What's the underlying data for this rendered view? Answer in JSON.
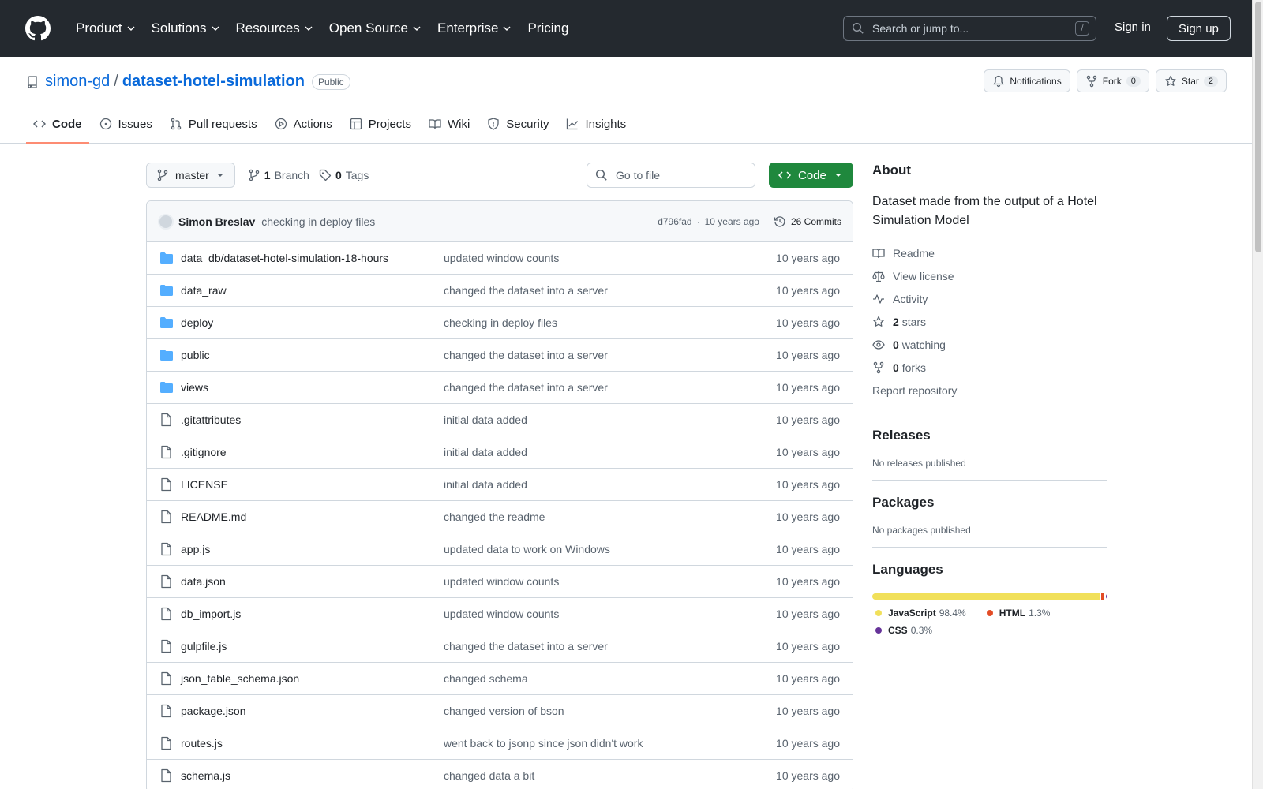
{
  "header": {
    "nav": [
      "Product",
      "Solutions",
      "Resources",
      "Open Source",
      "Enterprise",
      "Pricing"
    ],
    "search_placeholder": "Search or jump to...",
    "search_shortcut": "/",
    "signin": "Sign in",
    "signup": "Sign up"
  },
  "repo": {
    "owner": "simon-gd",
    "separator": "/",
    "name": "dataset-hotel-simulation",
    "visibility": "Public",
    "notifications_label": "Notifications",
    "fork_label": "Fork",
    "fork_count": "0",
    "star_label": "Star",
    "star_count": "2",
    "tabs": [
      "Code",
      "Issues",
      "Pull requests",
      "Actions",
      "Projects",
      "Wiki",
      "Security",
      "Insights"
    ]
  },
  "toolbar": {
    "branch": "master",
    "branch_count": "1",
    "branch_label": "Branch",
    "tag_count": "0",
    "tag_label": "Tags",
    "goto_placeholder": "Go to file",
    "code_button": "Code"
  },
  "commit": {
    "author": "Simon Breslav",
    "message": "checking in deploy files",
    "hash": "d796fad",
    "dot": "·",
    "time": "10 years ago",
    "commits": "26 Commits"
  },
  "files": [
    {
      "name": "data_db/dataset-hotel-simulation-18-hours",
      "type": "folder",
      "msg": "updated window counts",
      "date": "10 years ago"
    },
    {
      "name": "data_raw",
      "type": "folder",
      "msg": "changed the dataset into a server",
      "date": "10 years ago"
    },
    {
      "name": "deploy",
      "type": "folder",
      "msg": "checking in deploy files",
      "date": "10 years ago"
    },
    {
      "name": "public",
      "type": "folder",
      "msg": "changed the dataset into a server",
      "date": "10 years ago"
    },
    {
      "name": "views",
      "type": "folder",
      "msg": "changed the dataset into a server",
      "date": "10 years ago"
    },
    {
      "name": ".gitattributes",
      "type": "file",
      "msg": "initial data added",
      "date": "10 years ago"
    },
    {
      "name": ".gitignore",
      "type": "file",
      "msg": "initial data added",
      "date": "10 years ago"
    },
    {
      "name": "LICENSE",
      "type": "file",
      "msg": "initial data added",
      "date": "10 years ago"
    },
    {
      "name": "README.md",
      "type": "file",
      "msg": "changed the readme",
      "date": "10 years ago"
    },
    {
      "name": "app.js",
      "type": "file",
      "msg": "updated data to work on Windows",
      "date": "10 years ago"
    },
    {
      "name": "data.json",
      "type": "file",
      "msg": "updated window counts",
      "date": "10 years ago"
    },
    {
      "name": "db_import.js",
      "type": "file",
      "msg": "updated window counts",
      "date": "10 years ago"
    },
    {
      "name": "gulpfile.js",
      "type": "file",
      "msg": "changed the dataset into a server",
      "date": "10 years ago"
    },
    {
      "name": "json_table_schema.json",
      "type": "file",
      "msg": "changed schema",
      "date": "10 years ago"
    },
    {
      "name": "package.json",
      "type": "file",
      "msg": "changed version of bson",
      "date": "10 years ago"
    },
    {
      "name": "routes.js",
      "type": "file",
      "msg": "went back to jsonp since json didn't work",
      "date": "10 years ago"
    },
    {
      "name": "schema.js",
      "type": "file",
      "msg": "changed data a bit",
      "date": "10 years ago"
    }
  ],
  "about": {
    "title": "About",
    "description": "Dataset made from the output of a Hotel Simulation Model",
    "readme": "Readme",
    "license": "View license",
    "activity": "Activity",
    "stars_count": "2",
    "stars_label": "stars",
    "watching_count": "0",
    "watching_label": "watching",
    "forks_count": "0",
    "forks_label": "forks",
    "report": "Report repository"
  },
  "releases": {
    "title": "Releases",
    "text": "No releases published"
  },
  "packages": {
    "title": "Packages",
    "text": "No packages published"
  },
  "languages": {
    "title": "Languages",
    "items": [
      {
        "name": "JavaScript",
        "percent": "98.4%",
        "value": 98.4,
        "color": "#f1e05a"
      },
      {
        "name": "HTML",
        "percent": "1.3%",
        "value": 1.3,
        "color": "#e34c26"
      },
      {
        "name": "CSS",
        "percent": "0.3%",
        "value": 0.3,
        "color": "#663399"
      }
    ]
  },
  "colors": {
    "accent": "#0969da",
    "code_button": "#1f883d",
    "header_bg": "#24292f",
    "active_tab": "#fd8c73",
    "folder": "#54aeff"
  }
}
